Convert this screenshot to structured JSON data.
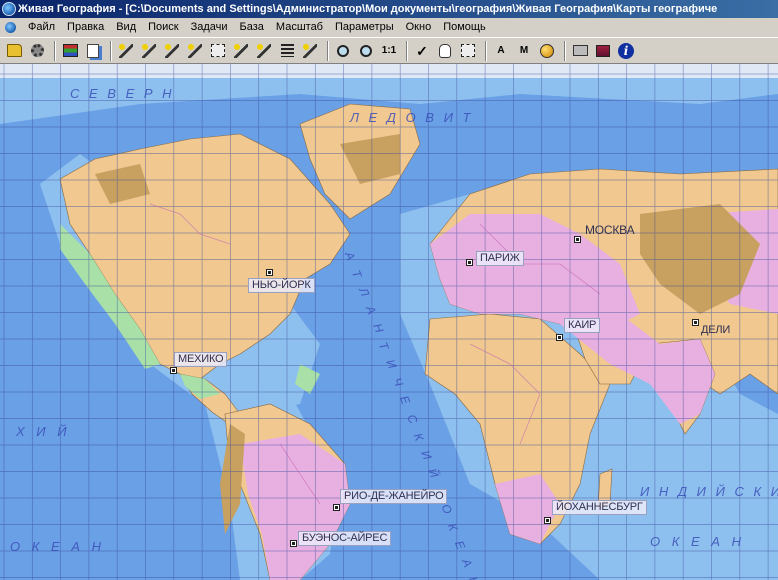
{
  "window": {
    "title": "Живая География - [C:\\Documents and Settings\\Администратор\\Мои документы\\география\\Живая География\\Карты географиче"
  },
  "menu": {
    "items": [
      "Файл",
      "Правка",
      "Вид",
      "Поиск",
      "Задачи",
      "База",
      "Масштаб",
      "Параметры",
      "Окно",
      "Помощь"
    ]
  },
  "toolbar": {
    "scale_1_1_label": "1:1",
    "label_tool_a": "A",
    "label_tool_m": "M"
  },
  "map": {
    "colors": {
      "ocean": "#6aa0e6",
      "shelf": "#8ec0ef",
      "land": "#f0c890",
      "green_zone": "#a8e0a8",
      "pink_zone": "#e8b0e0",
      "mountain": "#c8a060",
      "grid": "#3a4a9a",
      "ice": "#dfe8f4"
    },
    "cities": [
      {
        "name": "НЬЮ-ЙОРК",
        "boxed": true
      },
      {
        "name": "МЕХИКО",
        "boxed": true
      },
      {
        "name": "ПАРИЖ",
        "boxed": true
      },
      {
        "name": "МОСКВА",
        "boxed": false
      },
      {
        "name": "КАИР",
        "boxed": true
      },
      {
        "name": "ДЕЛИ",
        "boxed": false
      },
      {
        "name": "РИО-ДЕ-ЖАНЕЙРО",
        "boxed": true
      },
      {
        "name": "БУЭНОС-АЙРЕС",
        "boxed": true
      },
      {
        "name": "ЙОХАННЕСБУРГ",
        "boxed": true
      }
    ],
    "ocean_labels": {
      "arctic_left": "С Е В Е Р Н",
      "arctic_right": "Л Е Д О В И Т",
      "pacific_left": "Х И Й",
      "pacific_left_ocean": "О К Е А Н",
      "atlantic": "АТЛАНТИЧЕСКИЙ ОКЕАН",
      "indian": "И Н Д И Й С К И Й",
      "indian_ocean": "О К Е А Н"
    }
  }
}
